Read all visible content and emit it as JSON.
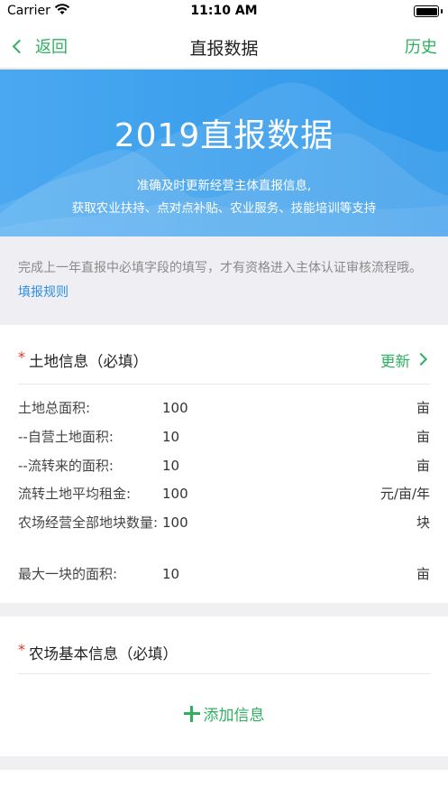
{
  "status_bar": {
    "carrier": "Carrier",
    "wifi_icon": "wifi-icon",
    "time": "11:10 AM",
    "battery_icon": "battery-icon"
  },
  "nav": {
    "back_label": "返回",
    "title": "直报数据",
    "history_label": "历史"
  },
  "banner": {
    "title": "2019直报数据",
    "subtitle_line1": "准确及时更新经营主体直报信息,",
    "subtitle_line2": "获取农业扶持、点对点补贴、农业服务、技能培训等支持",
    "colors": {
      "start": "#4aa8f0",
      "end": "#2d97ea"
    }
  },
  "notice": {
    "text": "完成上一年直报中必填字段的填写，才有资格进入主体认证审核流程哦。",
    "link_label": "填报规则"
  },
  "land_info": {
    "required_mark": "*",
    "title": "土地信息（必填）",
    "update_label": "更新",
    "rows": [
      {
        "label": "土地总面积:",
        "value": "100",
        "unit": "亩"
      },
      {
        "label": "--自营土地面积:",
        "value": "10",
        "unit": "亩"
      },
      {
        "label": "--流转来的面积:",
        "value": "10",
        "unit": "亩"
      },
      {
        "label": "流转土地平均租金:",
        "value": "100",
        "unit": "元/亩/年"
      },
      {
        "label": "农场经营全部地块数量:",
        "value": "100",
        "unit": "块"
      },
      {
        "label": "最大一块的面积:",
        "value": "10",
        "unit": "亩"
      }
    ]
  },
  "farm_info": {
    "required_mark": "*",
    "title": "农场基本信息（必填）",
    "add_label": "添加信息"
  },
  "colors": {
    "accent_green": "#2fb061",
    "link_blue": "#2d8ee0",
    "required_red": "#e0362b"
  }
}
